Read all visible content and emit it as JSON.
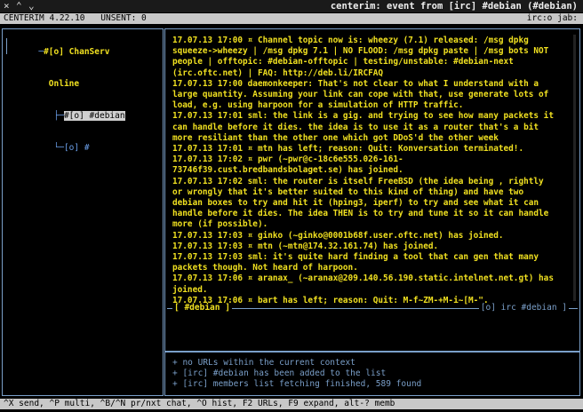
{
  "window": {
    "close_glyph": "×",
    "up_glyph": "⌃",
    "down_glyph": "⌄",
    "title": "centerim: event from [irc] #debian (#debian)"
  },
  "statusbar": {
    "app_name": "CENTERIM 4.22.10",
    "unsent": "UNSENT: 0",
    "right": "irc:o jab:"
  },
  "contacts": {
    "rows": [
      {
        "prefix": "─",
        "text": "#[o] ChanServ"
      },
      {
        "prefix": "  ",
        "text": "Online"
      },
      {
        "prefix": "   ├─",
        "text": "#[o] #debian",
        "selected": true
      },
      {
        "prefix": "   └─",
        "text": "[o] #"
      }
    ]
  },
  "chat": {
    "messages": [
      "17.07.13 17:00 ¤ Channel topic now is: wheezy (7.1) released: /msg dpkg squeeze->wheezy | /msg dpkg 7.1 | NO FLOOD: /msg dpkg paste | /msg bots NOT people | offtopic: #debian-offtopic | testing/unstable: #debian-next (irc.oftc.net) | FAQ: http://deb.li/IRCFAQ",
      "17.07.13 17:00 daemonkeeper: That's not clear to what I understand with a large quantity. Assuming your link can cope with that, use generate lots of load, e.g. using harpoon for a simulation of HTTP traffic.",
      "17.07.13 17:01 sml: the link is a gig. and trying to see how many packets it can handle before it dies. the idea is to use it as a router that's a bit more resiliant than the other one which got DDoS'd the other week",
      "17.07.13 17:01 ¤ mtn has left; reason: Quit: Konversation terminated!.",
      "17.07.13 17:02 ¤ pwr (~pwr@c-18c6e555.026-161-73746f39.cust.bredbandsbolaget.se) has joined.",
      "17.07.13 17:02 sml: the router is itself FreeBSD (the idea being , rightly or wrongly that it's better suited to this kind of thing) and have two debian boxes to try and hit it (hping3, iperf) to try and see what it can handle before it dies. The idea THEN is to try and tune it so it can handle more (if possible).",
      "17.07.13 17:03 ¤ ginko (~ginko@0001b68f.user.oftc.net) has joined.",
      "17.07.13 17:03 ¤ mtn (~mtn@174.32.161.74) has joined.",
      "17.07.13 17:03 sml: it's quite hard finding a tool that can gen that many packets though. Not heard of harpoon.",
      "17.07.13 17:06 ¤ aranax_ (~aranax@209.140.56.190.static.intelnet.net.gt) has joined.",
      "17.07.13 17:06 ¤ bart has left; reason: Quit: M-f~ZM-+M-i~[M-\"."
    ],
    "footer_left": "[ #debian ]",
    "footer_right": "[o] irc #debian ]"
  },
  "system_messages": [
    "+ no URLs within the current context",
    "+ [irc] #debian has been added to the list",
    "+ [irc] members list fetching finished, 589 found"
  ],
  "hints": "^X send, ^P multi, ^B/^N pr/nxt chat, ^O hist, F2 URLs, F9 expand, alt-? memb",
  "colors": {
    "accent_yellow": "#f0e020",
    "frame_blue": "#7a9fc9",
    "bar_gray": "#c8c8c8",
    "background": "#000000"
  }
}
